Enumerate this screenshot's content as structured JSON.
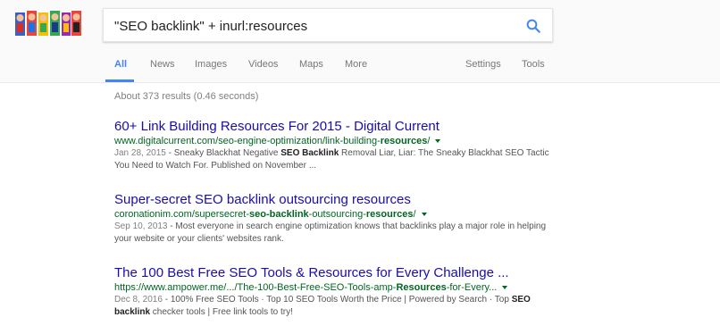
{
  "search": {
    "query": "\"SEO backlink\" + inurl:resources"
  },
  "tabs": [
    {
      "label": "All"
    },
    {
      "label": "News"
    },
    {
      "label": "Images"
    },
    {
      "label": "Videos"
    },
    {
      "label": "Maps"
    },
    {
      "label": "More"
    },
    {
      "label": "Settings"
    },
    {
      "label": "Tools"
    }
  ],
  "result_stats": "About 373 results (0.46 seconds)",
  "results": [
    {
      "title": "60+ Link Building Resources For 2015 - Digital Current",
      "url_pre": "www.digitalcurrent.com/seo-engine-optimization/link-building-",
      "url_bold": "resources",
      "url_post": "/",
      "date": "Jan 28, 2015",
      "s1": " - Sneaky Blackhat Negative ",
      "s1b": "SEO Backlink",
      "s2": " Removal Liar, Liar: The Sneaky Blackhat SEO Tactic You Need to Watch For. Published on November ..."
    },
    {
      "title": "Super-secret SEO backlink outsourcing resources",
      "url_pre": "coronationim.com/supersecret-",
      "url_bold": "seo-backlink",
      "url_mid": "-outsourcing-",
      "url_bold2": "resources",
      "url_post": "/",
      "date": "Sep 10, 2013",
      "s1": " - Most everyone in search engine optimization knows that backlinks play a major role in helping your website or your clients' websites rank."
    },
    {
      "title": "The 100 Best Free SEO Tools & Resources for Every Challenge ...",
      "url_pre": "https://www.ampower.me/.../The-100-Best-Free-SEO-Tools-amp-",
      "url_bold": "Resources",
      "url_post": "-for-Every...",
      "date": "Dec 8, 2016",
      "s1": " - 100% Free SEO Tools · Top 10 SEO Tools Worth the Price | Powered by Search · Top ",
      "s1b": "SEO backlink",
      "s2": " checker tools | Free link tools to try!"
    }
  ]
}
